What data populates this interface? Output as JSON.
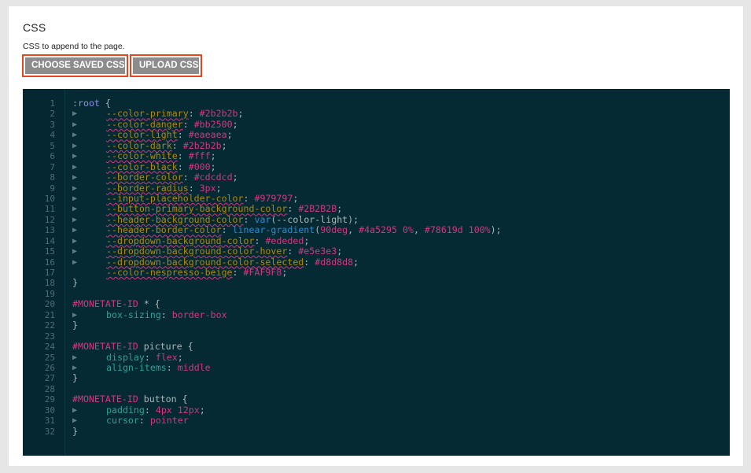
{
  "section": {
    "title": "CSS",
    "description": "CSS to append to the page."
  },
  "buttons": {
    "choose_saved": "CHOOSE SAVED CSS",
    "upload": "UPLOAD CSS"
  },
  "colors": {
    "accent_border": "#e8451e",
    "button_bg": "#8c8c8c",
    "editor_bg": "#062a33"
  },
  "editor": {
    "lines": [
      {
        "n": "1",
        "indent": false,
        "tokens": [
          {
            "t": ":root",
            "c": "sel"
          },
          {
            "t": " {",
            "c": ""
          }
        ]
      },
      {
        "n": "2",
        "indent": true,
        "tokens": [
          {
            "t": "--color-primary",
            "c": "var"
          },
          {
            "t": ": ",
            "c": ""
          },
          {
            "t": "#2b2b2b",
            "c": "val"
          },
          {
            "t": ";",
            "c": ""
          }
        ]
      },
      {
        "n": "3",
        "indent": true,
        "tokens": [
          {
            "t": "--color-danger",
            "c": "var"
          },
          {
            "t": ": ",
            "c": ""
          },
          {
            "t": "#bb2500",
            "c": "val"
          },
          {
            "t": ";",
            "c": ""
          }
        ]
      },
      {
        "n": "4",
        "indent": true,
        "tokens": [
          {
            "t": "--color-light",
            "c": "var"
          },
          {
            "t": ": ",
            "c": ""
          },
          {
            "t": "#eaeaea",
            "c": "val"
          },
          {
            "t": ";",
            "c": ""
          }
        ]
      },
      {
        "n": "5",
        "indent": true,
        "tokens": [
          {
            "t": "--color-dark",
            "c": "var"
          },
          {
            "t": ": ",
            "c": ""
          },
          {
            "t": "#2b2b2b",
            "c": "val"
          },
          {
            "t": ";",
            "c": ""
          }
        ]
      },
      {
        "n": "6",
        "indent": true,
        "tokens": [
          {
            "t": "--color-white",
            "c": "var"
          },
          {
            "t": ": ",
            "c": ""
          },
          {
            "t": "#fff",
            "c": "val"
          },
          {
            "t": ";",
            "c": ""
          }
        ]
      },
      {
        "n": "7",
        "indent": true,
        "tokens": [
          {
            "t": "--color-black",
            "c": "var"
          },
          {
            "t": ": ",
            "c": ""
          },
          {
            "t": "#000",
            "c": "val"
          },
          {
            "t": ";",
            "c": ""
          }
        ]
      },
      {
        "n": "8",
        "indent": true,
        "tokens": [
          {
            "t": "--border-color",
            "c": "var"
          },
          {
            "t": ": ",
            "c": ""
          },
          {
            "t": "#cdcdcd",
            "c": "val"
          },
          {
            "t": ";",
            "c": ""
          }
        ]
      },
      {
        "n": "9",
        "indent": true,
        "tokens": [
          {
            "t": "--border-radius",
            "c": "var"
          },
          {
            "t": ": ",
            "c": ""
          },
          {
            "t": "3px",
            "c": "val"
          },
          {
            "t": ";",
            "c": ""
          }
        ]
      },
      {
        "n": "10",
        "indent": true,
        "tokens": [
          {
            "t": "--input-placeholder-color",
            "c": "var"
          },
          {
            "t": ": ",
            "c": ""
          },
          {
            "t": "#979797",
            "c": "val"
          },
          {
            "t": ";",
            "c": ""
          }
        ]
      },
      {
        "n": "11",
        "indent": true,
        "tokens": [
          {
            "t": "--button-primary-background-color",
            "c": "var"
          },
          {
            "t": ": ",
            "c": ""
          },
          {
            "t": "#2B2B2B",
            "c": "val"
          },
          {
            "t": ";",
            "c": ""
          }
        ]
      },
      {
        "n": "12",
        "indent": true,
        "tokens": [
          {
            "t": "--header-background-color",
            "c": "var"
          },
          {
            "t": ": ",
            "c": ""
          },
          {
            "t": "var",
            "c": "fn"
          },
          {
            "t": "(--color-light);",
            "c": ""
          }
        ]
      },
      {
        "n": "13",
        "indent": true,
        "tokens": [
          {
            "t": "--header-border-color",
            "c": "var"
          },
          {
            "t": ": ",
            "c": ""
          },
          {
            "t": "linear-gradient",
            "c": "fn"
          },
          {
            "t": "(",
            "c": ""
          },
          {
            "t": "90deg",
            "c": "val"
          },
          {
            "t": ", ",
            "c": ""
          },
          {
            "t": "#4a5295 0%",
            "c": "val"
          },
          {
            "t": ", ",
            "c": ""
          },
          {
            "t": "#78619d 100%",
            "c": "val"
          },
          {
            "t": ");",
            "c": ""
          }
        ]
      },
      {
        "n": "14",
        "indent": true,
        "tokens": [
          {
            "t": "--dropdown-background-color",
            "c": "var"
          },
          {
            "t": ": ",
            "c": ""
          },
          {
            "t": "#ededed",
            "c": "val"
          },
          {
            "t": ";",
            "c": ""
          }
        ]
      },
      {
        "n": "15",
        "indent": true,
        "tokens": [
          {
            "t": "--dropdown-background-color-hover",
            "c": "var"
          },
          {
            "t": ": ",
            "c": ""
          },
          {
            "t": "#e5e3e3",
            "c": "val"
          },
          {
            "t": ";",
            "c": ""
          }
        ]
      },
      {
        "n": "16",
        "indent": true,
        "tokens": [
          {
            "t": "--dropdown-background-color-selected",
            "c": "var"
          },
          {
            "t": ": ",
            "c": ""
          },
          {
            "t": "#d8d8d8",
            "c": "val"
          },
          {
            "t": ";",
            "c": ""
          }
        ]
      },
      {
        "n": "17",
        "indent": false,
        "pad": true,
        "tokens": [
          {
            "t": "--color-nespresso-beige",
            "c": "var"
          },
          {
            "t": ": ",
            "c": ""
          },
          {
            "t": "#FAF9F8",
            "c": "val"
          },
          {
            "t": ";",
            "c": ""
          }
        ]
      },
      {
        "n": "18",
        "indent": false,
        "tokens": [
          {
            "t": "}",
            "c": ""
          }
        ]
      },
      {
        "n": "19",
        "indent": false,
        "tokens": []
      },
      {
        "n": "20",
        "indent": false,
        "tokens": [
          {
            "t": "#MONETATE-ID",
            "c": "cls"
          },
          {
            "t": " * {",
            "c": ""
          }
        ]
      },
      {
        "n": "21",
        "indent": true,
        "tokens": [
          {
            "t": "box-sizing",
            "c": "prop"
          },
          {
            "t": ": ",
            "c": ""
          },
          {
            "t": "border-box",
            "c": "val"
          }
        ]
      },
      {
        "n": "22",
        "indent": false,
        "tokens": [
          {
            "t": "}",
            "c": ""
          }
        ]
      },
      {
        "n": "23",
        "indent": false,
        "tokens": []
      },
      {
        "n": "24",
        "indent": false,
        "tokens": [
          {
            "t": "#MONETATE-ID",
            "c": "cls"
          },
          {
            "t": " picture {",
            "c": ""
          }
        ]
      },
      {
        "n": "25",
        "indent": true,
        "tokens": [
          {
            "t": "display",
            "c": "prop"
          },
          {
            "t": ": ",
            "c": ""
          },
          {
            "t": "flex",
            "c": "val"
          },
          {
            "t": ";",
            "c": ""
          }
        ]
      },
      {
        "n": "26",
        "indent": true,
        "tokens": [
          {
            "t": "align-items",
            "c": "prop"
          },
          {
            "t": ": ",
            "c": ""
          },
          {
            "t": "middle",
            "c": "val"
          }
        ]
      },
      {
        "n": "27",
        "indent": false,
        "tokens": [
          {
            "t": "}",
            "c": ""
          }
        ]
      },
      {
        "n": "28",
        "indent": false,
        "tokens": []
      },
      {
        "n": "29",
        "indent": false,
        "tokens": [
          {
            "t": "#MONETATE-ID",
            "c": "cls"
          },
          {
            "t": " button {",
            "c": ""
          }
        ]
      },
      {
        "n": "30",
        "indent": true,
        "tokens": [
          {
            "t": "padding",
            "c": "prop"
          },
          {
            "t": ": ",
            "c": ""
          },
          {
            "t": "4px 12px",
            "c": "val"
          },
          {
            "t": ";",
            "c": ""
          }
        ]
      },
      {
        "n": "31",
        "indent": true,
        "tokens": [
          {
            "t": "cursor",
            "c": "prop"
          },
          {
            "t": ": ",
            "c": ""
          },
          {
            "t": "pointer",
            "c": "val"
          }
        ]
      },
      {
        "n": "32",
        "indent": false,
        "tokens": [
          {
            "t": "}",
            "c": ""
          }
        ]
      }
    ]
  }
}
